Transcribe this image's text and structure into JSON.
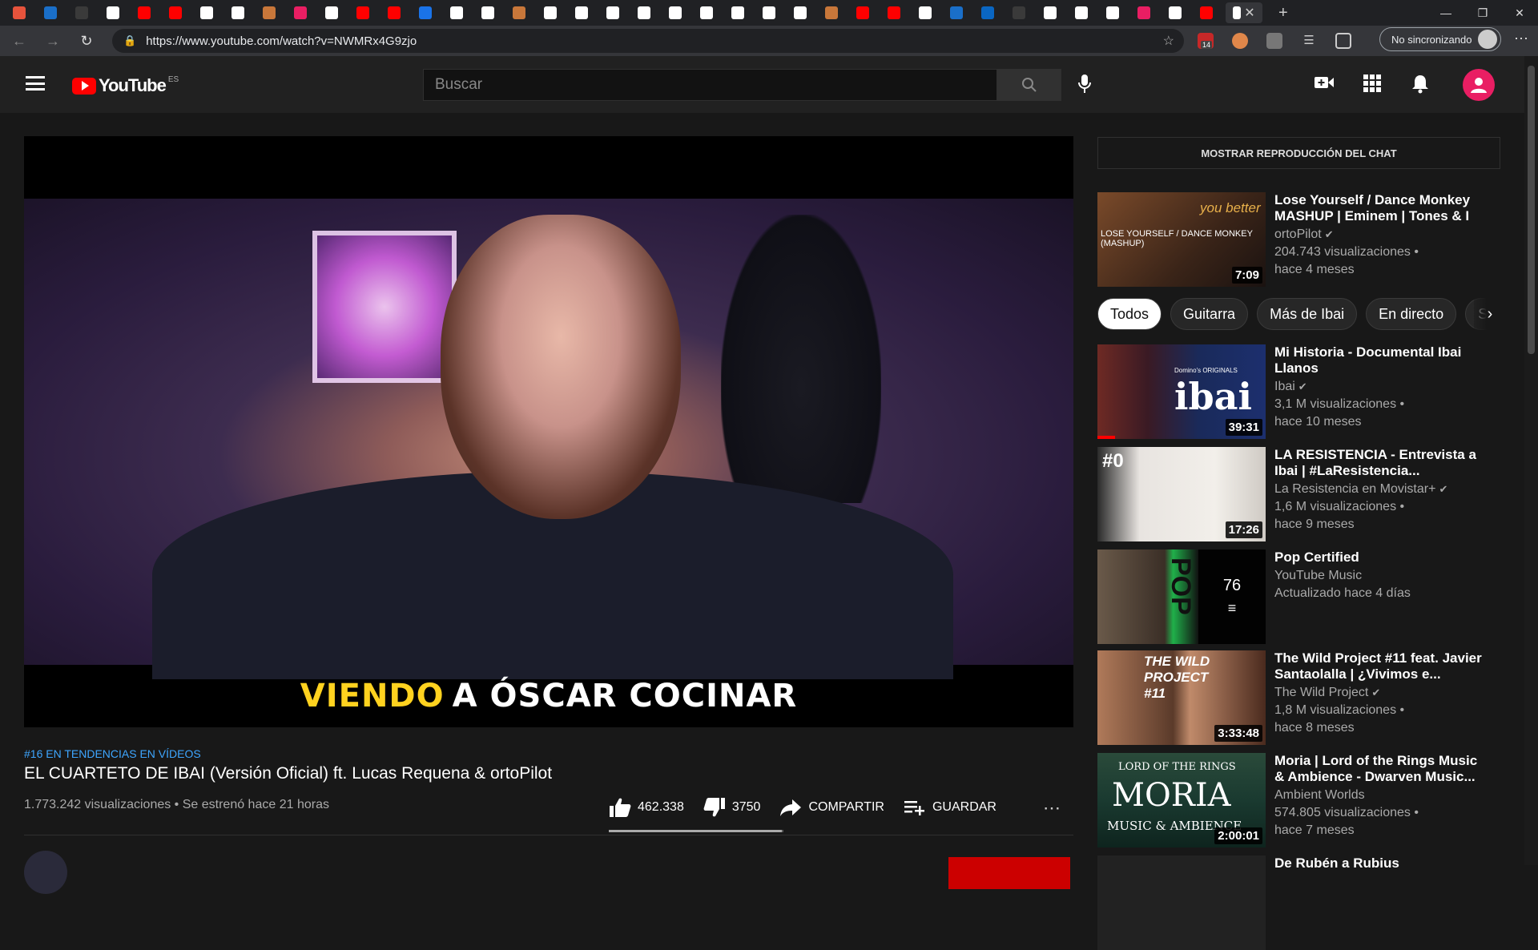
{
  "browser": {
    "url": "https://www.youtube.com/watch?v=NWMRx4G9zjo",
    "sync_label": "No sincronizando",
    "extension_badge": "14",
    "tab_colors": [
      "#e6533c",
      "#1a6fc9",
      "#3a3a3a",
      "#ffffff",
      "#ff0000",
      "#ff0000",
      "#ffffff",
      "#ffffff",
      "#c8773a",
      "#e91e63",
      "#ffffff",
      "#ff0000",
      "#ff0000",
      "#1a73e8",
      "#ffffff",
      "#ffffff",
      "#c8773a",
      "#ffffff",
      "#ffffff",
      "#ffffff",
      "#ffffff",
      "#ffffff",
      "#ffffff",
      "#ffffff",
      "#ffffff",
      "#ffffff",
      "#c8773a",
      "#ff0000",
      "#ff0000",
      "#ffffff",
      "#1a6fc9",
      "#0a66c2",
      "#3a3a3a",
      "#ffffff",
      "#ffffff",
      "#ffffff",
      "#e91e63",
      "#ffffff",
      "#ff0000"
    ]
  },
  "yt": {
    "logo_text": "YouTube",
    "region": "ES",
    "search_placeholder": "Buscar"
  },
  "video": {
    "subtitle_yellow": "VIENDO",
    "subtitle_white": "A ÓSCAR COCINAR",
    "hashtag": "#16 EN TENDENCIAS EN VÍDEOS",
    "title": "EL CUARTETO DE IBAI (Versión Oficial) ft. Lucas Requena & ortoPilot",
    "meta": "1.773.242 visualizaciones • Se estrenó hace 21 horas",
    "likes": "462.338",
    "dislikes": "3750",
    "share_label": "COMPARTIR",
    "save_label": "GUARDAR",
    "like_ratio": 0.992
  },
  "sidebar": {
    "chat_button": "MOSTRAR REPRODUCCIÓN DEL CHAT",
    "chips": [
      "Todos",
      "Guitarra",
      "Más de Ibai",
      "En directo",
      "S"
    ],
    "recs": [
      {
        "title": "Lose Yourself / Dance Monkey MASHUP | Eminem | Tones & I ...",
        "channel": "ortoPilot",
        "verified": true,
        "views": "204.743 visualizaciones •",
        "age": "hace 4 meses",
        "duration": "7:09",
        "thumb_text": "LOSE YOURSELF / DANCE MONKEY (MASHUP)",
        "thumb_text2": "you better"
      },
      {
        "title": "Mi Historia - Documental Ibai Llanos",
        "channel": "Ibai",
        "verified": true,
        "views": "3,1 M visualizaciones •",
        "age": "hace 10 meses",
        "duration": "39:31",
        "thumb_text": "ibai",
        "thumb_text2": "Domino's ORIGINALS"
      },
      {
        "title": "LA RESISTENCIA - Entrevista a Ibai | #LaResistencia...",
        "channel": "La Resistencia en Movistar+",
        "verified": true,
        "views": "1,6 M visualizaciones •",
        "age": "hace 9 meses",
        "duration": "17:26",
        "thumb_text": "#0"
      },
      {
        "title": "Pop Certified",
        "channel": "YouTube Music",
        "verified": false,
        "views": "Actualizado hace 4 días",
        "age": "",
        "playlist_count": "76",
        "thumb_text": "POP"
      },
      {
        "title": "The Wild Project #11 feat. Javier Santaolalla | ¿Vivimos e...",
        "channel": "The Wild Project",
        "verified": true,
        "views": "1,8 M visualizaciones •",
        "age": "hace 8 meses",
        "duration": "3:33:48",
        "thumb_text": "THE WILD PROJECT #11"
      },
      {
        "title": "Moria | Lord of the Rings Music & Ambience - Dwarven Music...",
        "channel": "Ambient Worlds",
        "verified": false,
        "views": "574.805 visualizaciones •",
        "age": "hace 7 meses",
        "duration": "2:00:01",
        "thumb_text": "MORIA",
        "thumb_text2": "LORD OF THE RINGS",
        "thumb_text3": "MUSIC & AMBIENCE"
      },
      {
        "title": "De Rubén a Rubius",
        "channel": "",
        "verified": false,
        "views": "",
        "age": "",
        "duration": ""
      }
    ]
  },
  "icons": {
    "search": "search-icon",
    "mic": "mic-icon",
    "create": "create-video-icon",
    "apps": "apps-icon",
    "notifications": "bell-icon"
  }
}
